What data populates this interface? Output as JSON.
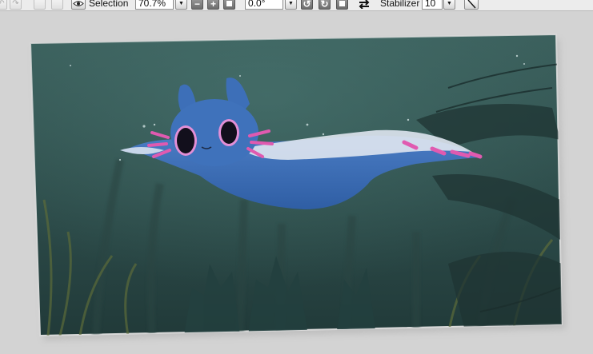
{
  "toolbar": {
    "selection_label": "Selection",
    "zoom_value": "70.7%",
    "rotation_value": "0.0°",
    "stabilizer_label": "Stabilizer",
    "stabilizer_value": "10"
  },
  "icons": {
    "undo": "undo-icon",
    "redo": "redo-icon",
    "eye": "eye-icon",
    "zoom_out": "minus-icon",
    "zoom_in": "plus-icon",
    "rotate_left": "rotate-left-icon",
    "rotate_right": "rotate-right-icon",
    "flip": "flip-horizontal-icon",
    "pen": "pen-tool-icon"
  },
  "colors": {
    "water": "#2f4d4b",
    "creature": "#3c6cb2",
    "gills": "#e05ab0"
  }
}
